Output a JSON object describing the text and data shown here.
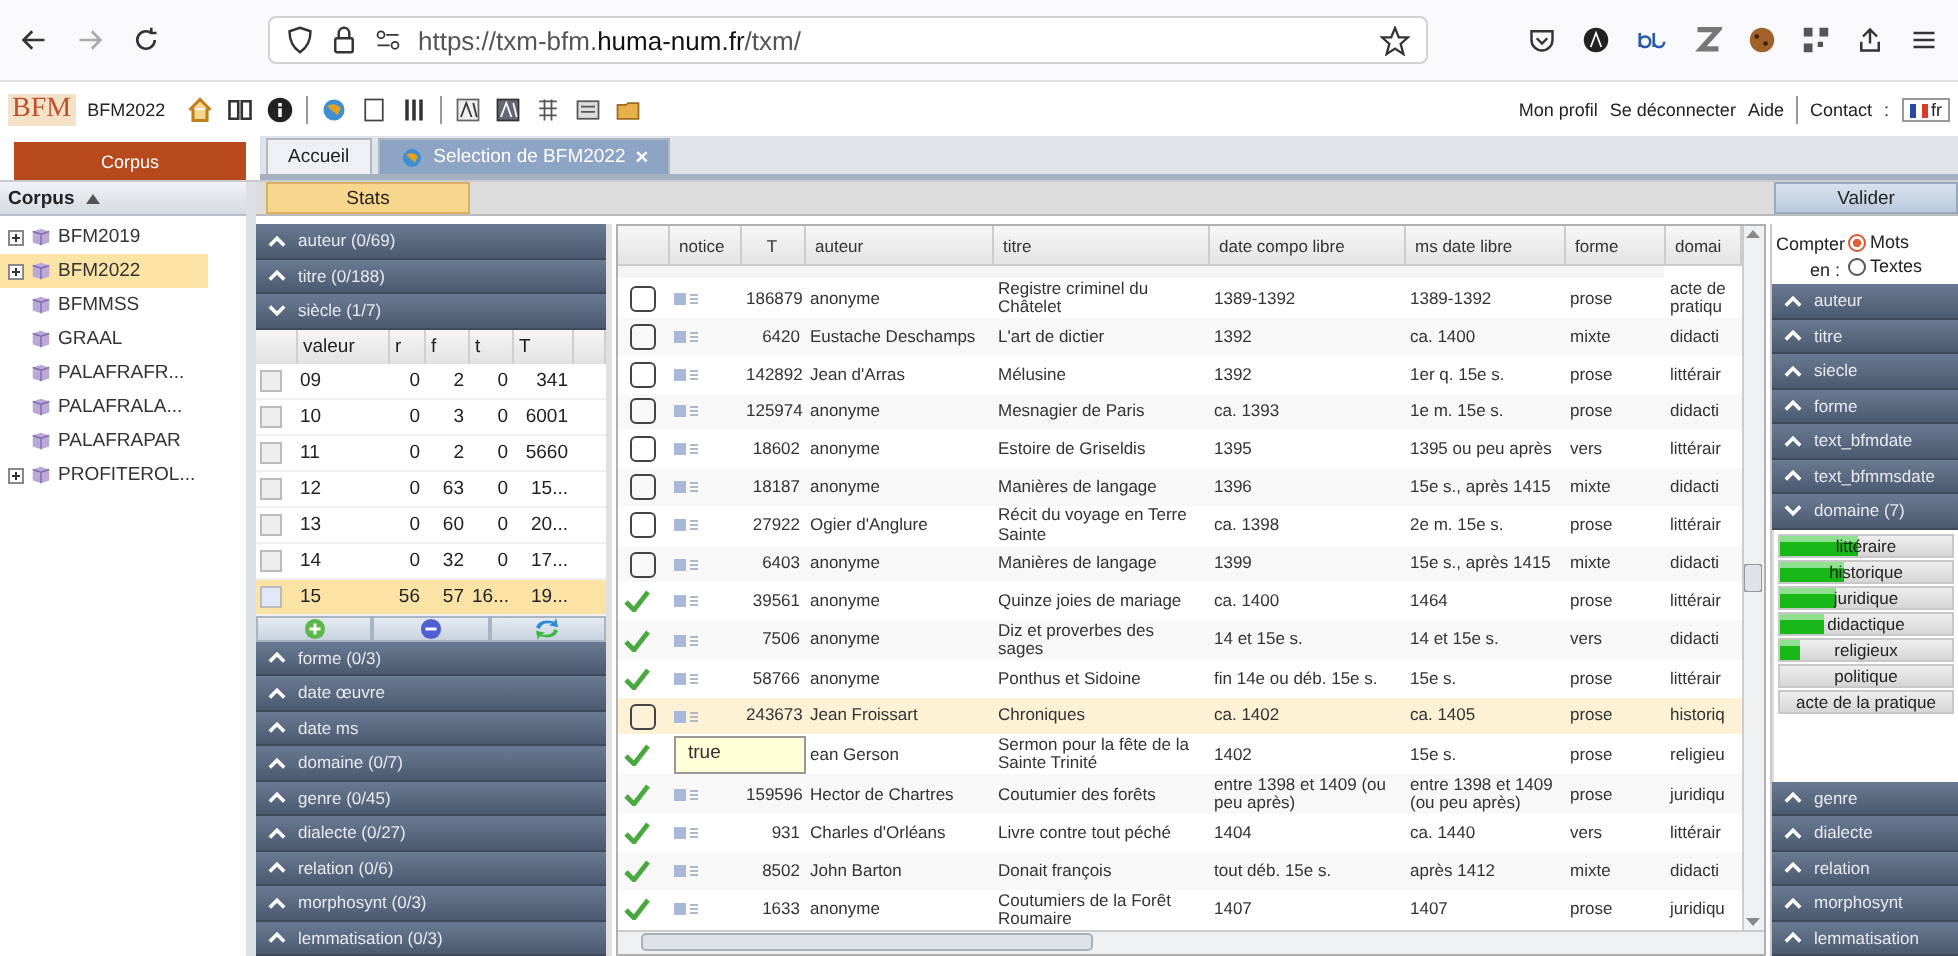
{
  "browser": {
    "url": "https://txm-bfm.**huma-num.fr**/txm/"
  },
  "app_bar": {
    "logo": "BFM",
    "corpus": "BFM2022",
    "links": [
      "Mon profil",
      "Se déconnecter",
      "Aide",
      "Contact"
    ],
    "separator": ":",
    "language": "fr"
  },
  "left_tab": {
    "label": "Corpus",
    "selected": true
  },
  "tabs": [
    {
      "label": "Accueil",
      "selected": false
    },
    {
      "label": "Selection de BFM2022",
      "selected": true,
      "close": "×"
    }
  ],
  "corpus_tree": {
    "title": "Corpus",
    "items": [
      {
        "label": "BFM2019",
        "expandable": true,
        "selected": false
      },
      {
        "label": "BFM2022",
        "expandable": true,
        "selected": true
      },
      {
        "label": "BFMMSS",
        "expandable": false,
        "selected": false
      },
      {
        "label": "GRAAL",
        "expandable": false,
        "selected": false
      },
      {
        "label": "PALAFRAFR...",
        "expandable": false,
        "selected": false
      },
      {
        "label": "PALAFRALA...",
        "expandable": false,
        "selected": false
      },
      {
        "label": "PALAFRAPAR",
        "expandable": false,
        "selected": false
      },
      {
        "label": "PROFITEROL...",
        "expandable": true,
        "selected": false
      }
    ]
  },
  "stats": {
    "button": "Stats",
    "valider": "Valider",
    "facets": [
      {
        "label": "auteur (0/69)",
        "expanded": false
      },
      {
        "label": "titre (0/188)",
        "expanded": false
      },
      {
        "label": "siècle (1/7)",
        "expanded": true,
        "table": {
          "columns": [
            "valeur",
            "r",
            "f",
            "t",
            "T"
          ],
          "rows": [
            {
              "checked": false,
              "cells": [
                "09",
                "0",
                "2",
                "0",
                "341"
              ]
            },
            {
              "checked": false,
              "cells": [
                "10",
                "0",
                "3",
                "0",
                "6001"
              ]
            },
            {
              "checked": false,
              "cells": [
                "11",
                "0",
                "2",
                "0",
                "5660"
              ]
            },
            {
              "checked": false,
              "cells": [
                "12",
                "0",
                "63",
                "0",
                "15..."
              ]
            },
            {
              "checked": false,
              "cells": [
                "13",
                "0",
                "60",
                "0",
                "20..."
              ]
            },
            {
              "checked": false,
              "cells": [
                "14",
                "0",
                "32",
                "0",
                "17..."
              ]
            },
            {
              "checked": true,
              "cells": [
                "15",
                "56",
                "57",
                "16...",
                "19..."
              ]
            }
          ]
        }
      },
      {
        "label": "forme (0/3)",
        "expanded": false
      },
      {
        "label": "date œuvre",
        "expanded": false
      },
      {
        "label": "date ms",
        "expanded": false
      },
      {
        "label": "domaine (0/7)",
        "expanded": false
      },
      {
        "label": "genre (0/45)",
        "expanded": false
      },
      {
        "label": "dialecte (0/27)",
        "expanded": false
      },
      {
        "label": "relation (0/6)",
        "expanded": false
      },
      {
        "label": "morphosynt (0/3)",
        "expanded": false
      },
      {
        "label": "lemmatisation (0/3)",
        "expanded": false
      }
    ]
  },
  "table": {
    "columns": [
      "notice",
      "T",
      "auteur",
      "titre",
      "date compo libre",
      "ms date libre",
      "forme",
      "domai"
    ],
    "rows": [
      {
        "checked": false,
        "selected": false,
        "t": "186879",
        "auteur": "anonyme",
        "titre": "Registre criminel du Châtelet",
        "date": "1389-1392",
        "ms_date": "1389-1392",
        "forme": "prose",
        "domaine": "acte de pratiqu"
      },
      {
        "checked": false,
        "selected": false,
        "t": "6420",
        "auteur": "Eustache Deschamps",
        "titre": "L'art de dictier",
        "date": "1392",
        "ms_date": "ca. 1400",
        "forme": "mixte",
        "domaine": "didacti"
      },
      {
        "checked": false,
        "selected": false,
        "t": "142892",
        "auteur": "Jean d'Arras",
        "titre": "Mélusine",
        "date": "1392",
        "ms_date": "1er q. 15e s.",
        "forme": "prose",
        "domaine": "littérair"
      },
      {
        "checked": false,
        "selected": false,
        "t": "125974",
        "auteur": "anonyme",
        "titre": "Mesnagier de Paris",
        "date": "ca. 1393",
        "ms_date": "1e m. 15e s.",
        "forme": "prose",
        "domaine": "didacti"
      },
      {
        "checked": false,
        "selected": false,
        "t": "18602",
        "auteur": "anonyme",
        "titre": "Estoire de Griseldis",
        "date": "1395",
        "ms_date": "1395 ou peu après",
        "forme": "vers",
        "domaine": "littérair"
      },
      {
        "checked": false,
        "selected": false,
        "t": "18187",
        "auteur": "anonyme",
        "titre": "Manières de langage",
        "date": "1396",
        "ms_date": "15e s., après 1415",
        "forme": "mixte",
        "domaine": "didacti"
      },
      {
        "checked": false,
        "selected": false,
        "t": "27922",
        "auteur": "Ogier d'Anglure",
        "titre": "Récit du voyage en Terre Sainte",
        "date": "ca. 1398",
        "ms_date": "2e m. 15e s.",
        "forme": "prose",
        "domaine": "littérair"
      },
      {
        "checked": false,
        "selected": false,
        "t": "6403",
        "auteur": "anonyme",
        "titre": "Manières de langage",
        "date": "1399",
        "ms_date": "15e s., après 1415",
        "forme": "mixte",
        "domaine": "didacti"
      },
      {
        "checked": true,
        "selected": false,
        "t": "39561",
        "auteur": "anonyme",
        "titre": "Quinze joies de mariage",
        "date": "ca. 1400",
        "ms_date": "1464",
        "forme": "prose",
        "domaine": "littérair"
      },
      {
        "checked": true,
        "selected": false,
        "t": "7506",
        "auteur": "anonyme",
        "titre": "Diz et proverbes des sages",
        "date": "14 et 15e s.",
        "ms_date": "14 et 15e s.",
        "forme": "vers",
        "domaine": "didacti"
      },
      {
        "checked": true,
        "selected": false,
        "t": "58766",
        "auteur": "anonyme",
        "titre": "Ponthus et Sidoine",
        "date": "fin 14e ou déb. 15e s.",
        "ms_date": "15e s.",
        "forme": "prose",
        "domaine": "littérair"
      },
      {
        "checked": false,
        "selected": true,
        "t": "243673",
        "auteur": "Jean Froissart",
        "titre": "Chroniques",
        "date": "ca. 1402",
        "ms_date": "ca. 1405",
        "forme": "prose",
        "domaine": "historiq"
      },
      {
        "checked": true,
        "selected": false,
        "tooltip": "true",
        "auteur": "ean Gerson",
        "titre": "Sermon pour la fête de la Sainte Trinité",
        "date": "1402",
        "ms_date": "15e s.",
        "forme": "prose",
        "domaine": "religieu"
      },
      {
        "checked": true,
        "selected": false,
        "t": "159596",
        "auteur": "Hector de Chartres",
        "titre": "Coutumier des forêts",
        "date": "entre 1398 et 1409 (ou peu après)",
        "ms_date": "entre 1398 et 1409 (ou peu après)",
        "forme": "prose",
        "domaine": "juridiqu"
      },
      {
        "checked": true,
        "selected": false,
        "t": "931",
        "auteur": "Charles d'Orléans",
        "titre": "Livre contre tout péché",
        "date": "1404",
        "ms_date": "ca. 1440",
        "forme": "vers",
        "domaine": "littérair"
      },
      {
        "checked": true,
        "selected": false,
        "t": "8502",
        "auteur": "John Barton",
        "titre": "Donait françois",
        "date": "tout déb. 15e s.",
        "ms_date": "après 1412",
        "forme": "mixte",
        "domaine": "didacti"
      },
      {
        "checked": true,
        "selected": false,
        "t": "1633",
        "auteur": "anonyme",
        "titre": "Coutumiers de la Forêt Roumaire",
        "date": "1407",
        "ms_date": "1407",
        "forme": "prose",
        "domaine": "juridiqu"
      }
    ]
  },
  "right_panel": {
    "count_label": "Compter en :",
    "options": [
      {
        "label": "Mots",
        "selected": true
      },
      {
        "label": "Textes",
        "selected": false
      }
    ],
    "facets": [
      {
        "label": "auteur",
        "expanded": false
      },
      {
        "label": "titre",
        "expanded": false
      },
      {
        "label": "siecle",
        "expanded": false
      },
      {
        "label": "forme",
        "expanded": false
      },
      {
        "label": "text_bfmdate",
        "expanded": false
      },
      {
        "label": "text_bfmmsdate",
        "expanded": false
      },
      {
        "label": "domaine (7)",
        "expanded": true,
        "bars": [
          {
            "label": "littéraire",
            "level": 0.45
          },
          {
            "label": "historique",
            "level": 0.37
          },
          {
            "label": "juridique",
            "level": 0.32
          },
          {
            "label": "didactique",
            "level": 0.26
          },
          {
            "label": "religieux",
            "level": 0.12
          },
          {
            "label": "politique",
            "level": 0
          },
          {
            "label": "acte de la pratique",
            "level": 0
          }
        ]
      },
      {
        "label": "genre",
        "expanded": false
      },
      {
        "label": "dialecte",
        "expanded": false
      },
      {
        "label": "relation",
        "expanded": false
      },
      {
        "label": "morphosynt",
        "expanded": false
      },
      {
        "label": "lemmatisation",
        "expanded": false
      }
    ]
  }
}
